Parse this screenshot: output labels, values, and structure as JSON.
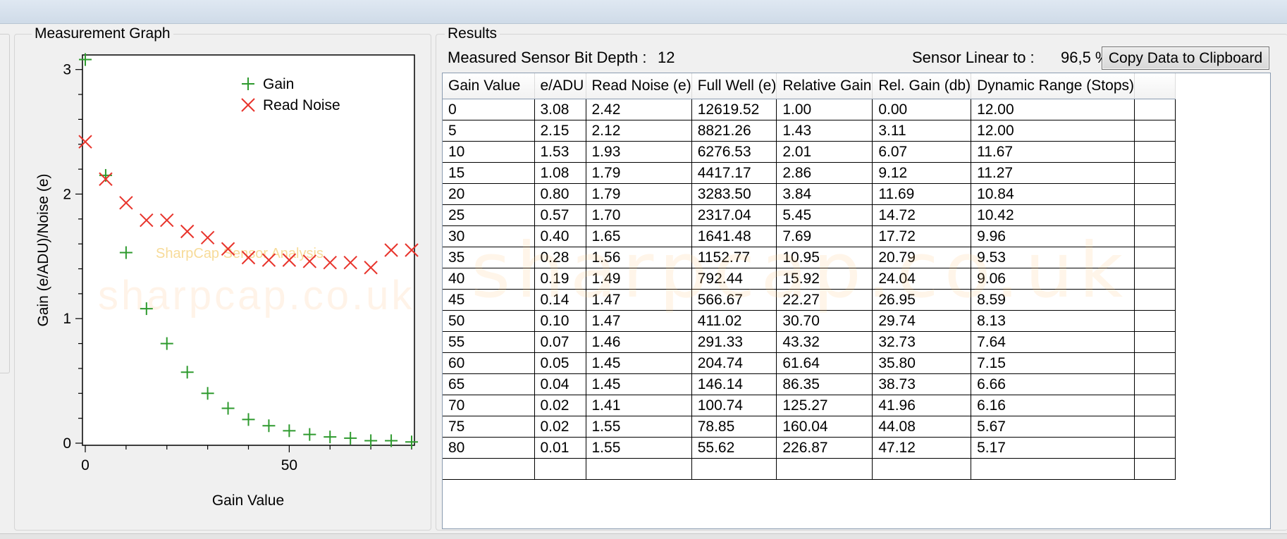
{
  "graph": {
    "title": "Measurement Graph",
    "watermark_small": "SharpCap Sensor Analysis",
    "watermark_large": "sharpcap.co.uk"
  },
  "chart_data": {
    "type": "scatter",
    "xlabel": "Gain Value",
    "ylabel": "Gain (e/ADU)/Noise (e)",
    "xlim": [
      0,
      80
    ],
    "ylim": [
      0,
      3.1
    ],
    "x_ticks": [
      0,
      50
    ],
    "y_ticks": [
      0,
      1,
      2,
      3
    ],
    "legend_position": "top-right",
    "grid": false,
    "x": [
      0,
      5,
      10,
      15,
      20,
      25,
      30,
      35,
      40,
      45,
      50,
      55,
      60,
      65,
      70,
      75,
      80
    ],
    "series": [
      {
        "name": "Gain",
        "marker": "plus",
        "color": "#2e9a2e",
        "values": [
          3.08,
          2.15,
          1.53,
          1.08,
          0.8,
          0.57,
          0.4,
          0.28,
          0.19,
          0.14,
          0.1,
          0.07,
          0.05,
          0.04,
          0.02,
          0.02,
          0.01
        ]
      },
      {
        "name": "Read Noise",
        "marker": "cross",
        "color": "#e8342c",
        "values": [
          2.42,
          2.12,
          1.93,
          1.79,
          1.79,
          1.7,
          1.65,
          1.56,
          1.49,
          1.47,
          1.47,
          1.46,
          1.45,
          1.45,
          1.41,
          1.55,
          1.55
        ]
      }
    ]
  },
  "results": {
    "title": "Results",
    "bit_depth_label": "Measured Sensor Bit Depth :",
    "bit_depth_value": "12",
    "linear_label": "Sensor Linear to :",
    "linear_value": "96,5 %",
    "copy_button_label": "Copy Data to Clipboard",
    "watermark": "sharpcap.co.uk",
    "columns": [
      "Gain Value",
      "e/ADU",
      "Read Noise (e)",
      "Full Well (e)",
      "Relative Gain",
      "Rel. Gain (db)",
      "Dynamic Range (Stops)"
    ],
    "rows": [
      [
        "0",
        "3.08",
        "2.42",
        "12619.52",
        "1.00",
        "0.00",
        "12.00"
      ],
      [
        "5",
        "2.15",
        "2.12",
        "8821.26",
        "1.43",
        "3.11",
        "12.00"
      ],
      [
        "10",
        "1.53",
        "1.93",
        "6276.53",
        "2.01",
        "6.07",
        "11.67"
      ],
      [
        "15",
        "1.08",
        "1.79",
        "4417.17",
        "2.86",
        "9.12",
        "11.27"
      ],
      [
        "20",
        "0.80",
        "1.79",
        "3283.50",
        "3.84",
        "11.69",
        "10.84"
      ],
      [
        "25",
        "0.57",
        "1.70",
        "2317.04",
        "5.45",
        "14.72",
        "10.42"
      ],
      [
        "30",
        "0.40",
        "1.65",
        "1641.48",
        "7.69",
        "17.72",
        "9.96"
      ],
      [
        "35",
        "0.28",
        "1.56",
        "1152.77",
        "10.95",
        "20.79",
        "9.53"
      ],
      [
        "40",
        "0.19",
        "1.49",
        "792.44",
        "15.92",
        "24.04",
        "9.06"
      ],
      [
        "45",
        "0.14",
        "1.47",
        "566.67",
        "22.27",
        "26.95",
        "8.59"
      ],
      [
        "50",
        "0.10",
        "1.47",
        "411.02",
        "30.70",
        "29.74",
        "8.13"
      ],
      [
        "55",
        "0.07",
        "1.46",
        "291.33",
        "43.32",
        "32.73",
        "7.64"
      ],
      [
        "60",
        "0.05",
        "1.45",
        "204.74",
        "61.64",
        "35.80",
        "7.15"
      ],
      [
        "65",
        "0.04",
        "1.45",
        "146.14",
        "86.35",
        "38.73",
        "6.66"
      ],
      [
        "70",
        "0.02",
        "1.41",
        "100.74",
        "125.27",
        "41.96",
        "6.16"
      ],
      [
        "75",
        "0.02",
        "1.55",
        "78.85",
        "160.04",
        "44.08",
        "5.67"
      ],
      [
        "80",
        "0.01",
        "1.55",
        "55.62",
        "226.87",
        "47.12",
        "5.17"
      ],
      [
        "",
        "",
        "",
        "",
        "",
        "",
        ""
      ]
    ]
  }
}
